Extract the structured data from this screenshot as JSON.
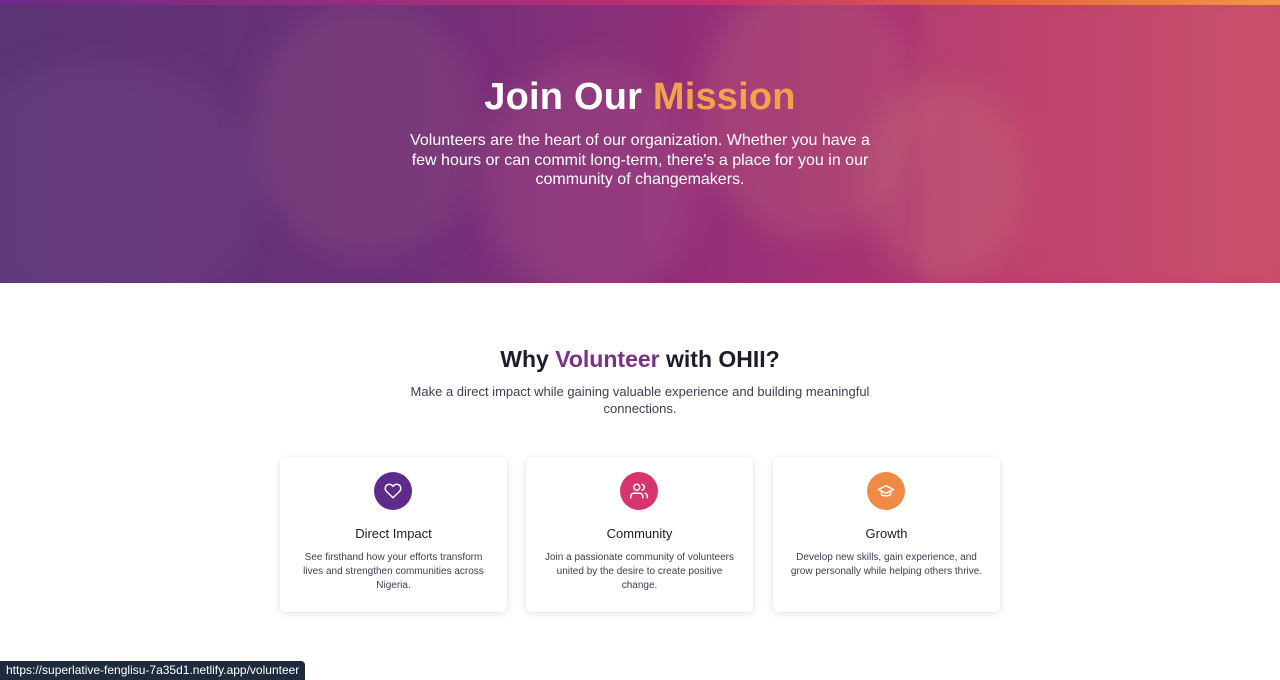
{
  "hero": {
    "title_main": "Join Our ",
    "title_accent": "Mission",
    "subtitle": "Volunteers are the heart of our organization. Whether you have a few hours or can commit long-term, there's a place for you in our community of changemakers."
  },
  "why": {
    "title_pre": "Why ",
    "title_accent": "Volunteer",
    "title_post": " with OHII?",
    "subtitle": "Make a direct impact while gaining valuable experience and building meaningful connections."
  },
  "cards": [
    {
      "icon": "heart-icon",
      "color": "#5e2a8c",
      "title": "Direct Impact",
      "desc": "See firsthand how your efforts transform lives and strengthen communities across Nigeria."
    },
    {
      "icon": "users-icon",
      "color": "#d6336f",
      "title": "Community",
      "desc": "Join a passionate community of volunteers united by the desire to create positive change."
    },
    {
      "icon": "graduation-cap-icon",
      "color": "#f08a45",
      "title": "Growth",
      "desc": "Develop new skills, gain experience, and grow personally while helping others thrive."
    }
  ],
  "status_url": "https://superlative-fenglisu-7a35d1.netlify.app/volunteer",
  "colors": {
    "accent_orange": "#f5a04a",
    "accent_purple": "#7b2f86"
  }
}
